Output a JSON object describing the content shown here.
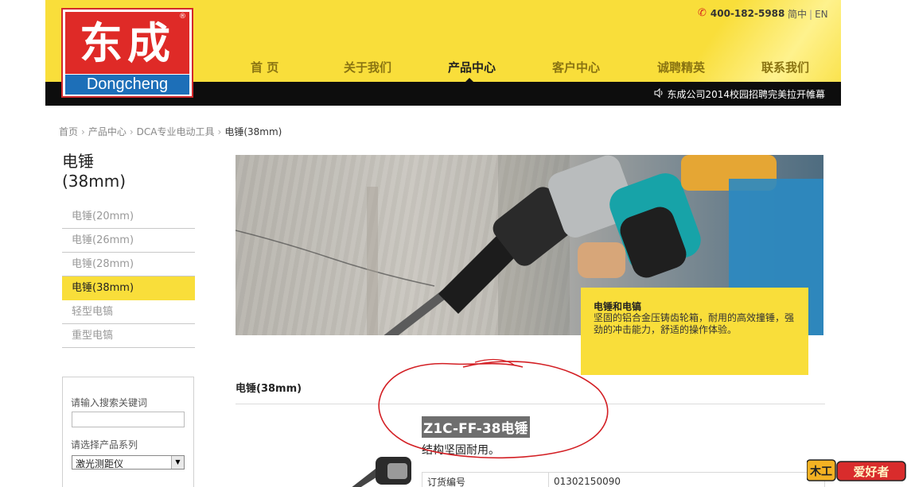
{
  "header": {
    "logo_cn": "东成",
    "logo_en": "Dongcheng",
    "logo_mark": "®",
    "phone": "400-182-5988",
    "lang_cn": "简中",
    "lang_en": "EN",
    "nav": [
      "首 页",
      "关于我们",
      "产品中心",
      "客户中心",
      "诚聘精英",
      "联系我们"
    ],
    "nav_active_index": 2,
    "news": "东成公司2014校园招聘完美拉开帷幕"
  },
  "breadcrumb": [
    "首页",
    "产品中心",
    "DCA专业电动工具",
    "电锤(38mm)"
  ],
  "sidebar": {
    "title_line1": "电锤",
    "title_line2": "(38mm)",
    "items": [
      {
        "label": "电锤(20mm)",
        "active": false
      },
      {
        "label": "电锤(26mm)",
        "active": false
      },
      {
        "label": "电锤(28mm)",
        "active": false
      },
      {
        "label": "电锤(38mm)",
        "active": true
      },
      {
        "label": "轻型电镐",
        "active": false
      },
      {
        "label": "重型电镐",
        "active": false
      }
    ],
    "search_label": "请输入搜索关键词",
    "search_value": "",
    "series_label": "请选择产品系列",
    "series_value": "激光测距仪"
  },
  "hero": {
    "caption_title": "电锤和电镐",
    "caption_body": "坚固的铝合金压铸齿轮箱，耐用的高效撞锤，强劲的冲击能力，舒适的操作体验。"
  },
  "product": {
    "section_title": "电锤(38mm)",
    "name": "Z1C-FF-38电锤",
    "tagline": "结构坚固耐用。",
    "spec_label": "订货编号",
    "spec_value": "01302150090"
  },
  "watermark": "爱好者",
  "watermark_badge": "木工",
  "colors": {
    "brand_yellow": "#f9de3a",
    "nav_bar_black": "#0d0d0d",
    "logo_red": "#df2a27",
    "logo_blue": "#1d6fb8",
    "annotation_red": "#d31f24"
  }
}
